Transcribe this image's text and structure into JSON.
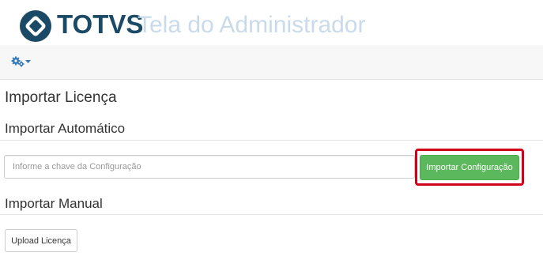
{
  "header": {
    "brand": "TOTVS",
    "app_title": "Tela do Administrador"
  },
  "navbar": {
    "menu_icon": "gears-dropdown-icon"
  },
  "page": {
    "title": "Importar Licença"
  },
  "auto_import": {
    "title": "Importar Automático",
    "input_placeholder": "Informe a chave da Configuração",
    "input_value": "",
    "button_label": "Importar Configuração"
  },
  "manual_import": {
    "title": "Importar Manual",
    "button_label": "Upload Licença"
  },
  "colors": {
    "brand": "#1a4a66",
    "title_faded": "#c9dbea",
    "success": "#5cb85c",
    "highlight": "#d0021b",
    "navbar_icon": "#337ab7"
  }
}
